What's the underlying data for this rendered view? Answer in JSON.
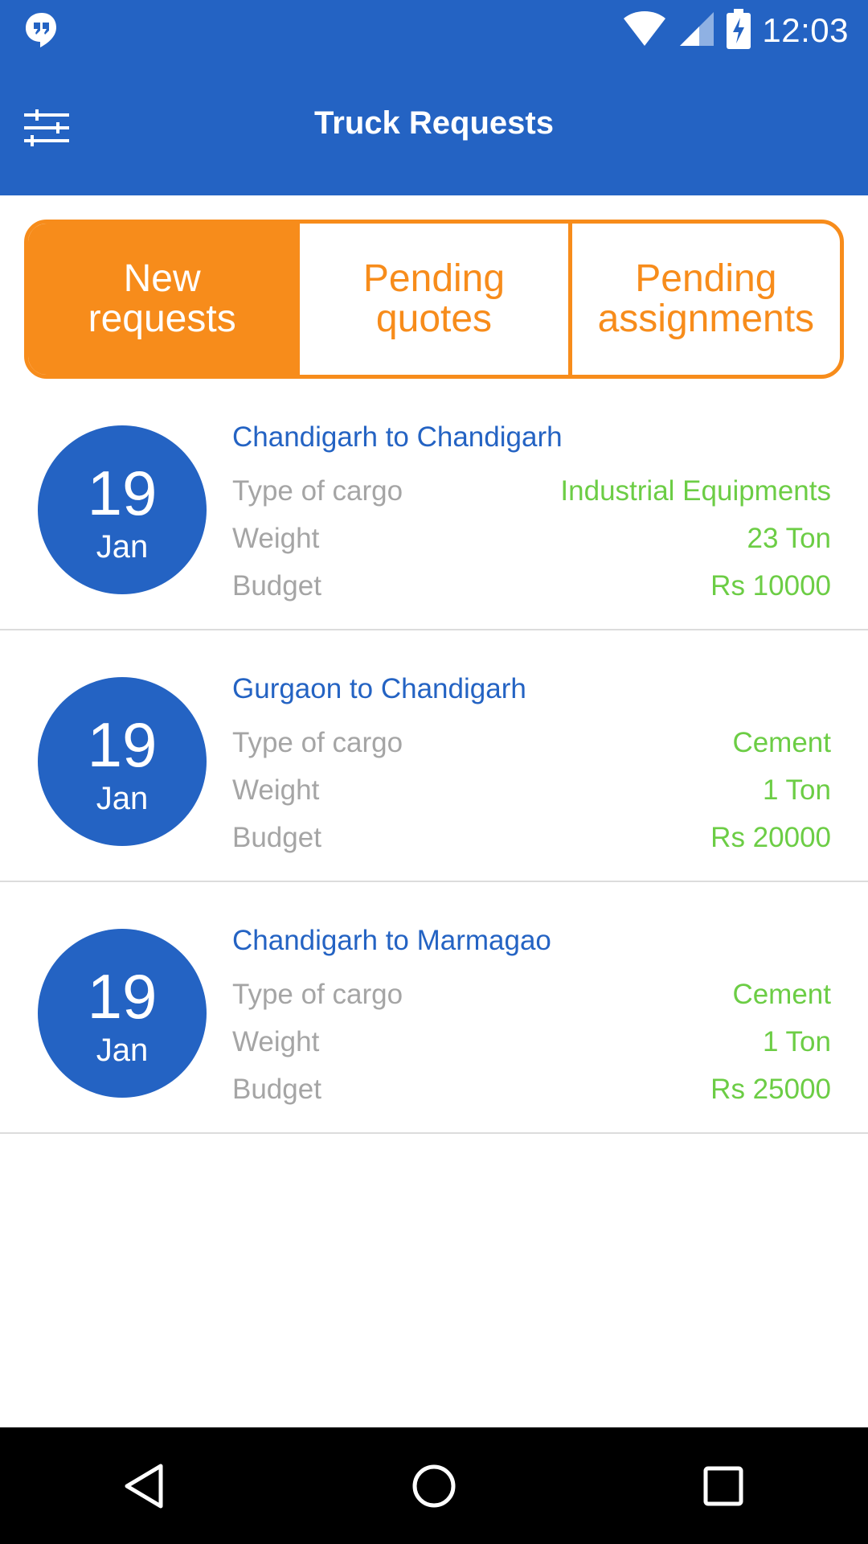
{
  "status_bar": {
    "time": "12:03",
    "icons": [
      "hangouts-notification-icon",
      "wifi-icon",
      "cell-signal-icon",
      "battery-charging-icon"
    ]
  },
  "app_bar": {
    "title": "Truck Requests",
    "left_icon": "filter-sliders-icon"
  },
  "tabs": [
    {
      "label": "New\nrequests",
      "active": true
    },
    {
      "label": "Pending\nquotes",
      "active": false
    },
    {
      "label": "Pending\nassignments",
      "active": false
    }
  ],
  "requests": [
    {
      "day": "19",
      "month": "Jan",
      "route": "Chandigarh to Chandigarh",
      "cargo_label": "Type of cargo",
      "cargo": "Industrial Equipments",
      "weight_label": "Weight",
      "weight": "23 Ton",
      "budget_label": "Budget",
      "budget": "Rs 10000"
    },
    {
      "day": "19",
      "month": "Jan",
      "route": "Gurgaon to Chandigarh",
      "cargo_label": "Type of cargo",
      "cargo": "Cement",
      "weight_label": "Weight",
      "weight": "1 Ton",
      "budget_label": "Budget",
      "budget": "Rs 20000"
    },
    {
      "day": "19",
      "month": "Jan",
      "route": "Chandigarh to Marmagao",
      "cargo_label": "Type of cargo",
      "cargo": "Cement",
      "weight_label": "Weight",
      "weight": "1 Ton",
      "budget_label": "Budget",
      "budget": "Rs 25000"
    }
  ],
  "nav_bar": {
    "buttons": [
      "back-icon",
      "home-icon",
      "recents-icon"
    ]
  },
  "colors": {
    "primary": "#2463c3",
    "accent": "#f78c1b",
    "value_green": "#6ccd45",
    "label_gray": "#a5a5a5"
  }
}
